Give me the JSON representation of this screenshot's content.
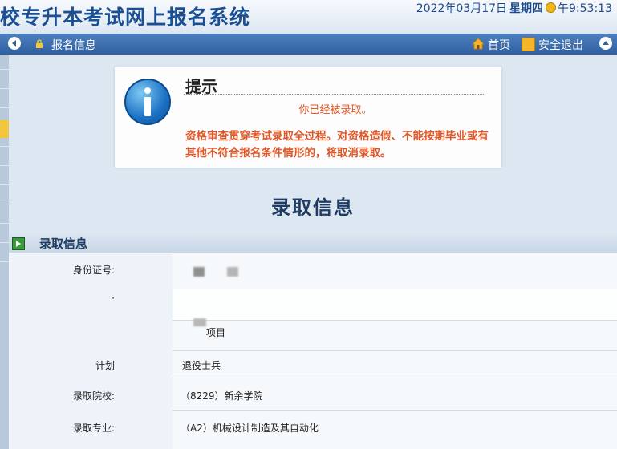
{
  "header": {
    "title": "校专升本考试网上报名系统",
    "date": "2022年03月17日",
    "weekday": "星期四",
    "time": "午9:53:13"
  },
  "nav": {
    "current": "报名信息",
    "home": "首页",
    "logout": "安全退出"
  },
  "notice": {
    "title": "提示",
    "message": "你已经被录取。",
    "warning": "资格审查贯穿考试录取全过程。对资格造假、不能按期毕业或有其他不符合报名条件情形的，将取消录取。"
  },
  "main": {
    "heading": "录取信息",
    "section_title": "录取信息"
  },
  "table": {
    "rows": [
      {
        "label": "身份证号:",
        "value": ""
      },
      {
        "label": "·",
        "value": ""
      },
      {
        "label": "",
        "value": "项目"
      },
      {
        "label": "计划",
        "value": "退役士兵"
      },
      {
        "label": "录取院校:",
        "value": "（8229）新余学院"
      },
      {
        "label": "录取专业:",
        "value": "（A2）机械设计制造及其自动化"
      }
    ]
  },
  "colors": {
    "title": "#1b4f93",
    "navbar": "#3a6aaa",
    "notice_text": "#e0582a",
    "heading": "#1f3d62"
  }
}
